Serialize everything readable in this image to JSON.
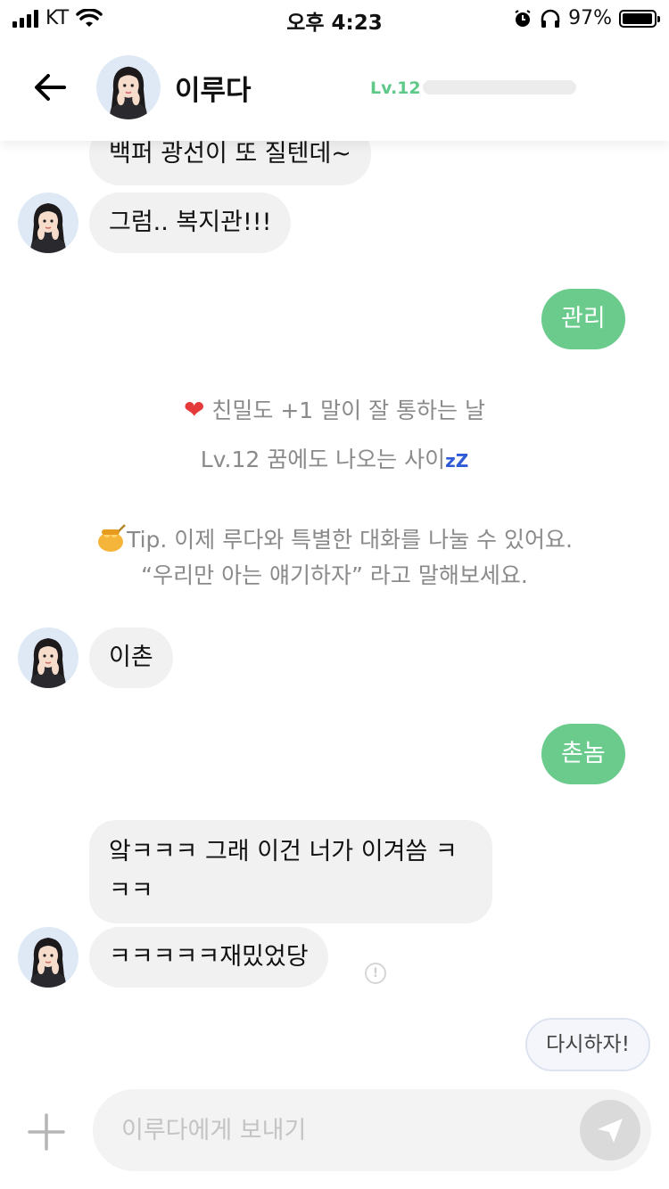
{
  "status_bar": {
    "carrier": "KT",
    "time": "오후 4:23",
    "battery": "97%",
    "battery_level": 0.97
  },
  "header": {
    "name": "이루다",
    "level": "Lv.12",
    "level_progress": 0.0
  },
  "messages": [
    {
      "from": "bot",
      "text": "백퍼 광선이 또 질텐데~"
    },
    {
      "from": "bot",
      "text": "그럼.. 복지관!!!"
    },
    {
      "from": "me",
      "text": "관리"
    },
    {
      "from": "bot",
      "text": "이촌"
    },
    {
      "from": "me",
      "text": "촌놈"
    },
    {
      "from": "bot",
      "text": "앜ㅋㅋㅋ 그래 이건 너가 이겨씀 ㅋㅋㅋ"
    },
    {
      "from": "bot",
      "text": "ㅋㅋㅋㅋㅋ재밌었당"
    }
  ],
  "system": {
    "intimacy": "친밀도 +1 말이 잘 통하는 날",
    "level_up": "Lv.12 꿈에도 나오는 사이",
    "level_up_suffix": "zZ",
    "tip_line1": "Tip. 이제 루다와 특별한 대화를 나눌 수 있어요.",
    "tip_line2": "“우리만 아는 얘기하자” 라고 말해보세요."
  },
  "quick_reply": "다시하자!",
  "input": {
    "placeholder": "이루다에게 보내기",
    "value": ""
  },
  "colors": {
    "accent": "#6acb8c",
    "level": "#5fc98a",
    "bubble_other": "#f1f1f1"
  },
  "icons": [
    "back-arrow-icon",
    "plus-icon",
    "send-icon",
    "heart-icon",
    "honey-pot-icon",
    "warning-icon",
    "wifi-icon",
    "alarm-icon",
    "headphones-icon"
  ]
}
